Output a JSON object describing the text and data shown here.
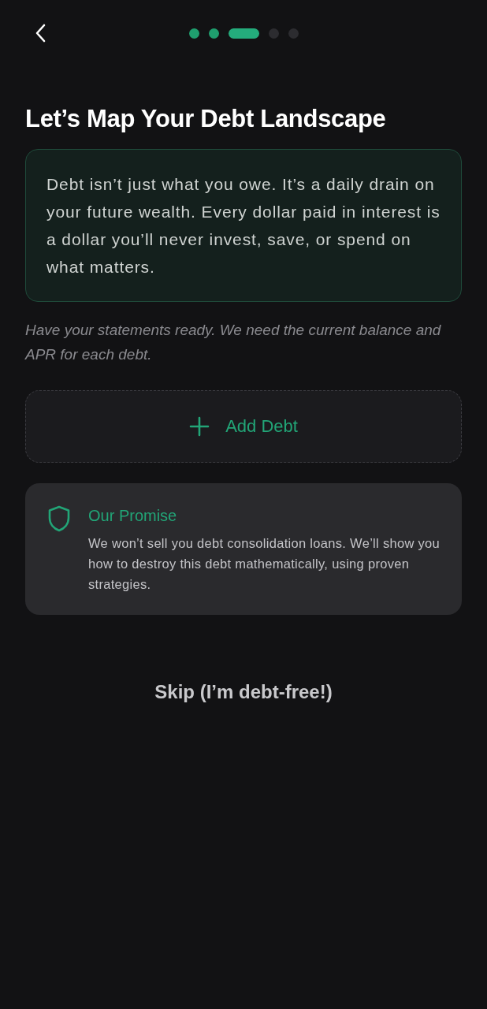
{
  "progress": [
    {
      "completed": true,
      "selected": false
    },
    {
      "completed": true,
      "selected": false
    },
    {
      "completed": false,
      "selected": true
    },
    {
      "completed": false,
      "selected": false
    },
    {
      "completed": false,
      "selected": false
    }
  ],
  "title": "Let’s Map Your Debt Landscape",
  "intro": "Debt isn’t just what you owe. It’s a daily drain on your future wealth. Every dollar paid in interest is a dollar you’ll never invest, save, or spend on what matters.",
  "note": "Have your statements ready. We need the current balance and APR for each debt.",
  "add_button": {
    "label": "Add Debt"
  },
  "promise": {
    "title": "Our Promise",
    "body": "We won’t sell you debt consolidation loans. We’ll show you how to destroy this debt mathematically, using proven strategies."
  },
  "skip_button": {
    "label": "Skip (I’m debt-free!)"
  }
}
